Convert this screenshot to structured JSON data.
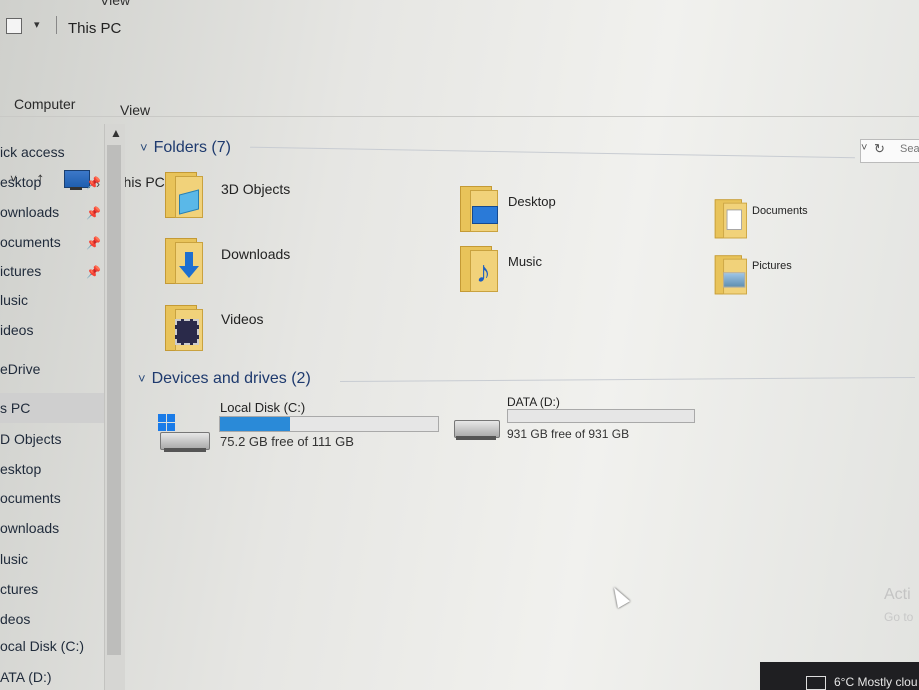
{
  "window": {
    "title": "This PC",
    "top_tab_partial": "View"
  },
  "ribbon": {
    "tabs": [
      "Computer",
      "View"
    ]
  },
  "address": {
    "path": "This PC",
    "search_placeholder": "Sea"
  },
  "sidebar": {
    "items": [
      {
        "label": "ick access"
      },
      {
        "label": "esktop",
        "pinned": true
      },
      {
        "label": "ownloads",
        "pinned": true
      },
      {
        "label": "ocuments",
        "pinned": true
      },
      {
        "label": "ictures",
        "pinned": true
      },
      {
        "label": "lusic"
      },
      {
        "label": "ideos"
      },
      {
        "label": "eDrive"
      },
      {
        "label": "s PC",
        "selected": true
      },
      {
        "label": "D Objects"
      },
      {
        "label": "esktop"
      },
      {
        "label": "ocuments"
      },
      {
        "label": "ownloads"
      },
      {
        "label": "lusic"
      },
      {
        "label": "ctures"
      },
      {
        "label": "deos"
      },
      {
        "label": "ocal Disk (C:)"
      },
      {
        "label": "ATA (D:)"
      }
    ]
  },
  "folders": {
    "header": "Folders (7)",
    "items": [
      {
        "label": "3D Objects",
        "icon": "3d-objects-icon"
      },
      {
        "label": "Desktop",
        "icon": "desktop-icon"
      },
      {
        "label": "Documents",
        "icon": "documents-icon"
      },
      {
        "label": "Downloads",
        "icon": "downloads-icon"
      },
      {
        "label": "Music",
        "icon": "music-icon"
      },
      {
        "label": "Pictures",
        "icon": "pictures-icon"
      },
      {
        "label": "Videos",
        "icon": "videos-icon"
      }
    ]
  },
  "drives": {
    "header": "Devices and drives (2)",
    "items": [
      {
        "label": "Local Disk (C:)",
        "free_text": "75.2 GB free of 111 GB",
        "used_fraction": 0.32
      },
      {
        "label": "DATA (D:)",
        "free_text": "931 GB free of 931 GB",
        "used_fraction": 0.0
      }
    ]
  },
  "watermark": {
    "line1": "Acti",
    "line2": "Go to"
  },
  "taskbar": {
    "weather": "6°C  Mostly clou"
  },
  "colors": {
    "accent_bar": "#2a8ad8",
    "folder_yellow": "#f1d27a",
    "header_blue": "#1e3a6e"
  }
}
